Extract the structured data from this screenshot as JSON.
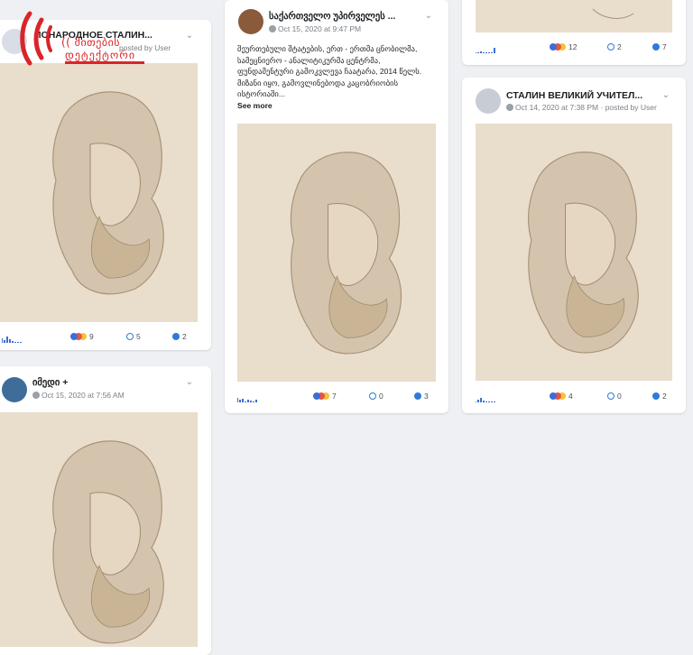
{
  "colors": {
    "accent": "#1877f2",
    "logo": "#d9252a",
    "bg": "#eef0f3"
  },
  "posts": [
    {
      "page_name": "ПОНАРОДНОЕ СТАЛИН...",
      "meta": "posted by User",
      "stats": {
        "reactions": "9",
        "comments": "5",
        "shares": "2"
      }
    },
    {
      "page_name": "საქართველო უპირველეს ...",
      "meta": "Oct 15, 2020 at 9:47 PM",
      "caption": "შეურთებული შტატების, ერთ - ერთმა ცნობილმა, სამეცნიერო - ანალიტიკურმა ცენტრმა, ფუნდამენტური გამოკვლევა ჩაატარა, 2014 წელს. მიზანი იყო, გამოვლინებოდა კაცობრიობის ისტორიაში...",
      "see_more": "See more",
      "stats": {
        "reactions": "7",
        "comments": "0",
        "shares": "3"
      }
    },
    {
      "stats": {
        "reactions": "12",
        "comments": "2",
        "shares": "7"
      }
    },
    {
      "page_name": "СТАЛИН ВЕЛИКИЙ УЧИТЕЛ...",
      "meta": "Oct 14, 2020 at 7:38 PM · posted by User",
      "stats": {
        "reactions": "4",
        "comments": "0",
        "shares": "2"
      }
    },
    {
      "page_name": "იმედი +",
      "meta": "Oct 15, 2020 at 7:56 AM"
    }
  ],
  "logo": {
    "line1": "(( მითების",
    "line2": "დეტექტორი"
  }
}
